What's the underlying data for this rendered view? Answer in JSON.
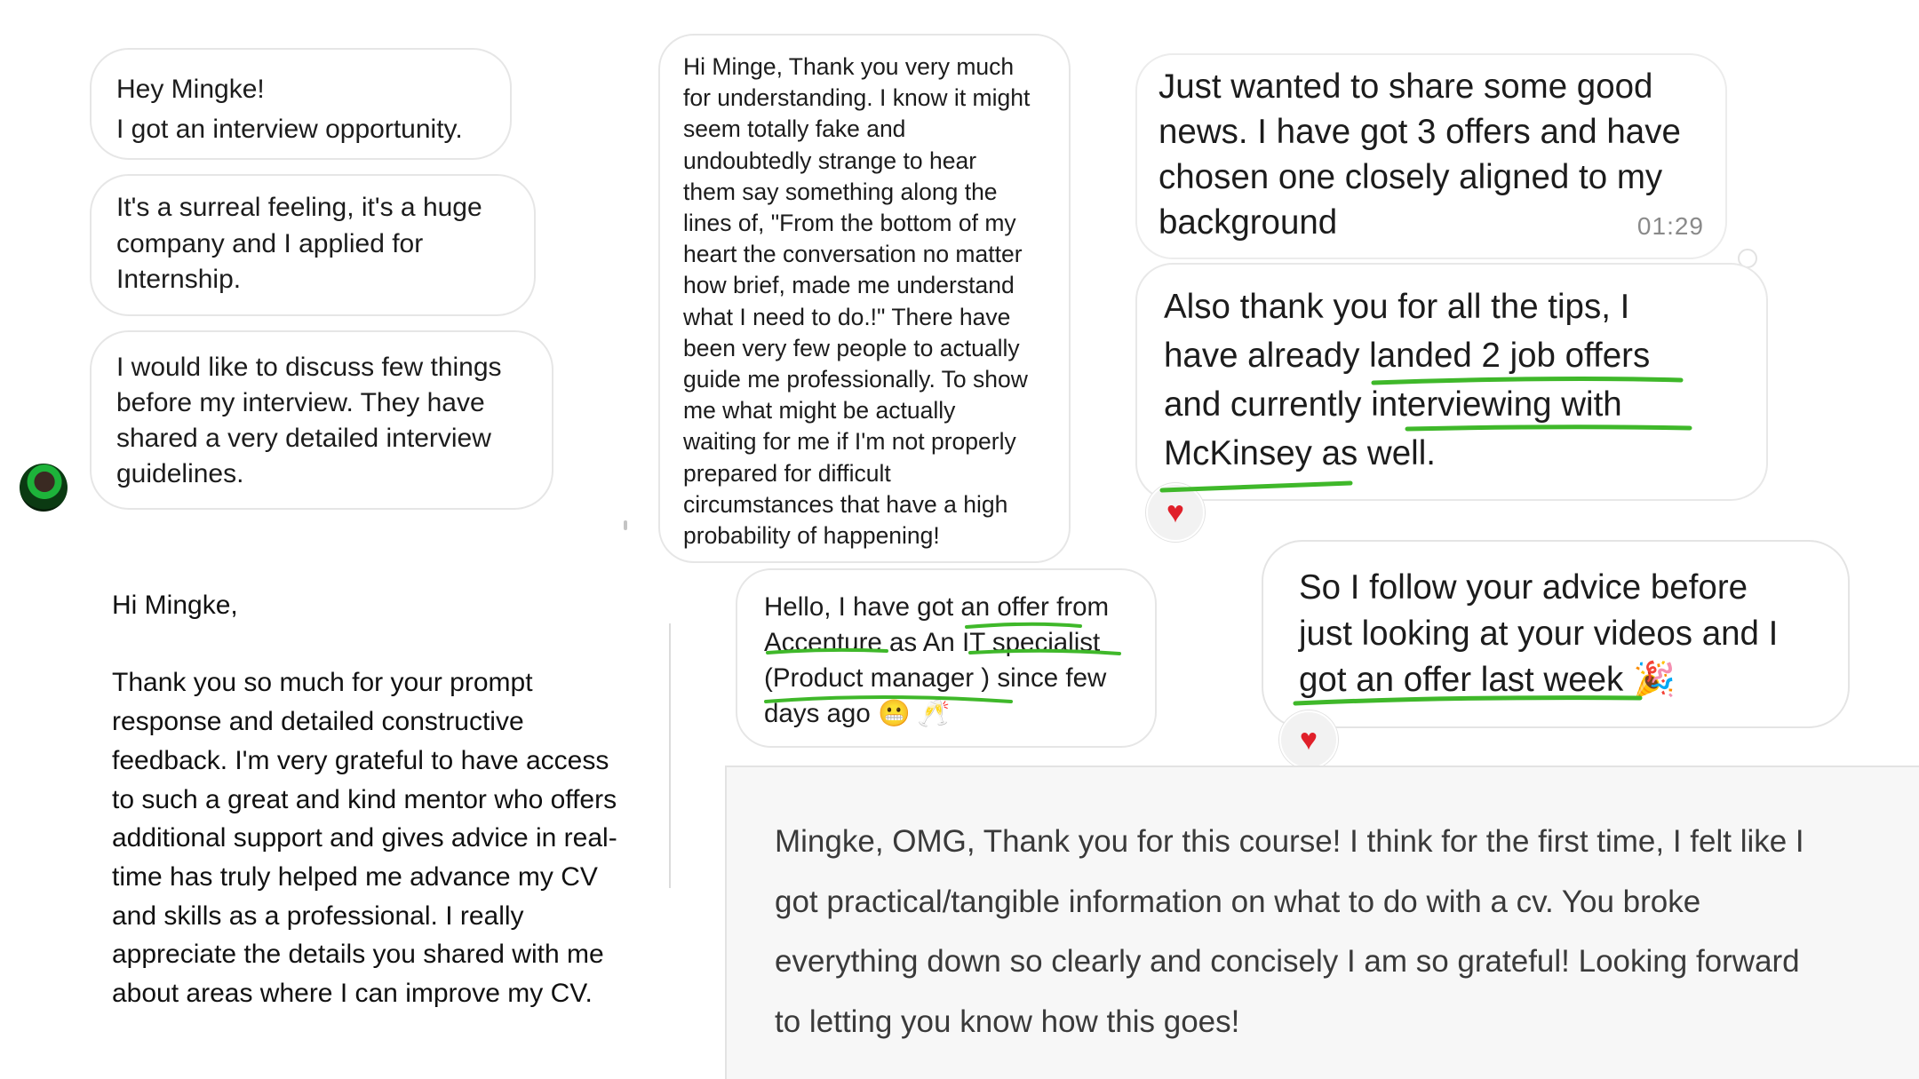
{
  "chat_left": {
    "messages": [
      "Hey Mingke!\nI got an interview opportunity.",
      "It's a surreal feeling, it's a huge\ncompany and I applied for\nInternship.",
      "I would like to discuss few things\nbefore my interview. They have\nshared a very detailed interview\nguidelines."
    ]
  },
  "long_message": "Hi Minge, Thank you very much\nfor understanding. I know it might\nseem totally fake and\nundoubtedly strange to hear\nthem say something along the\nlines of, \"From the bottom of my\nheart the conversation no matter\nhow brief, made me understand\nwhat I need to do.!\" There have\nbeen very few people to actually\nguide me professionally. To show\nme what might be actually\nwaiting for me if I'm not properly\nprepared for difficult\ncircumstances that have a high\nprobability of happening!",
  "accenture_message": "Hello, I have got an offer from\nAccenture as An IT specialist\n(Product manager ) since few\ndays ago",
  "accenture_emojis": "😬 🥂",
  "offers_message": {
    "text": "Just wanted to share some good\nnews. I have got 3 offers and have\nchosen one closely aligned to my\nbackground",
    "time": "01:29"
  },
  "tips_message": "Also thank you for all the tips, I\nhave already landed 2 job offers\nand currently interviewing with\nMcKinsey as well.",
  "advice_message": "So I follow your advice before\njust looking at your videos and I\ngot an offer last week",
  "advice_emoji": "🎉",
  "reaction": "♥",
  "email": {
    "greeting": "Hi Mingke,",
    "body": "Thank you so much for your prompt\nresponse and detailed constructive\nfeedback. I'm very grateful to have access\nto such a great and kind mentor who offers\nadditional support and gives advice in real-\ntime has truly helped me advance my CV\nand skills as a professional. I really\nappreciate the details you shared with me\nabout areas where I can improve my CV."
  },
  "course_review": "Mingke, OMG, Thank you for this course! I think for the first time, I felt like I\ngot practical/tangible information on what to do with a cv. You broke\neverything down so clearly and concisely I am so grateful! Looking forward\nto letting you know how this goes!",
  "colors": {
    "highlight": "#3fb82a",
    "heart": "#e0202a"
  }
}
